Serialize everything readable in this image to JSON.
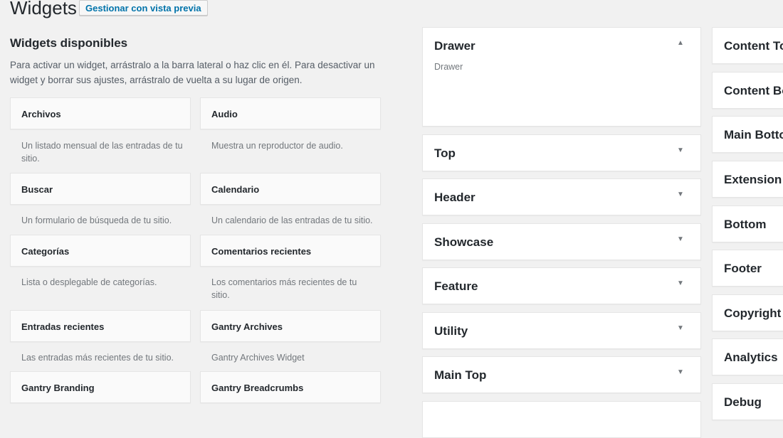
{
  "page": {
    "title": "Widgets",
    "preview_button": "Gestionar con vista previa"
  },
  "available": {
    "title": "Widgets disponibles",
    "description": "Para activar un widget, arrástralo a la barra lateral o haz clic en él. Para desactivar un widget y borrar sus ajustes, arrástralo de vuelta a su lugar de origen.",
    "widgets": [
      {
        "name": "Archivos",
        "desc": "Un listado mensual de las entradas de tu sitio."
      },
      {
        "name": "Audio",
        "desc": "Muestra un reproductor de audio."
      },
      {
        "name": "Buscar",
        "desc": "Un formulario de búsqueda de tu sitio."
      },
      {
        "name": "Calendario",
        "desc": "Un calendario de las entradas de tu sitio."
      },
      {
        "name": "Categorías",
        "desc": "Lista o desplegable de categorías."
      },
      {
        "name": "Comentarios recientes",
        "desc": "Los comentarios más recientes de tu sitio."
      },
      {
        "name": "Entradas recientes",
        "desc": "Las entradas más recientes de tu sitio."
      },
      {
        "name": "Gantry Archives",
        "desc": "Gantry Archives Widget"
      },
      {
        "name": "Gantry Branding",
        "desc": ""
      },
      {
        "name": "Gantry Breadcrumbs",
        "desc": ""
      }
    ]
  },
  "sidebars_left": [
    {
      "name": "Drawer",
      "desc": "Drawer",
      "icon": "arrow-up-icon"
    },
    {
      "name": "Top",
      "icon": "arrow-down-icon"
    },
    {
      "name": "Header",
      "icon": "arrow-down-icon"
    },
    {
      "name": "Showcase",
      "icon": "arrow-down-icon"
    },
    {
      "name": "Feature",
      "icon": "arrow-down-icon"
    },
    {
      "name": "Utility",
      "icon": "arrow-down-icon"
    },
    {
      "name": "Main Top",
      "icon": "arrow-down-icon"
    }
  ],
  "sidebars_right": [
    {
      "name": "Content To"
    },
    {
      "name": "Content Bo"
    },
    {
      "name": "Main Botto"
    },
    {
      "name": "Extension"
    },
    {
      "name": "Bottom"
    },
    {
      "name": "Footer"
    },
    {
      "name": "Copyright"
    },
    {
      "name": "Analytics"
    },
    {
      "name": "Debug"
    }
  ],
  "glyphs": {
    "up": "▲",
    "down": "▼"
  },
  "colors": {
    "link": "#0073aa",
    "background": "#f1f1f1"
  }
}
